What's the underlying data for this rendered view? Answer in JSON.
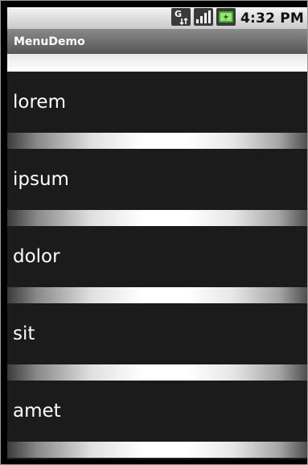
{
  "status_bar": {
    "time": "4:32 PM",
    "icons": [
      "data-transfer-icon",
      "signal-strength-icon",
      "battery-charging-icon"
    ]
  },
  "app": {
    "title": "MenuDemo"
  },
  "list": {
    "items": [
      "lorem",
      "ipsum",
      "dolor",
      "sit",
      "amet"
    ]
  },
  "colors": {
    "list_background": "#1b1b1b",
    "title_bar": "#6e6e6e",
    "battery_green": "#3fae2a",
    "text": "#ffffff"
  }
}
